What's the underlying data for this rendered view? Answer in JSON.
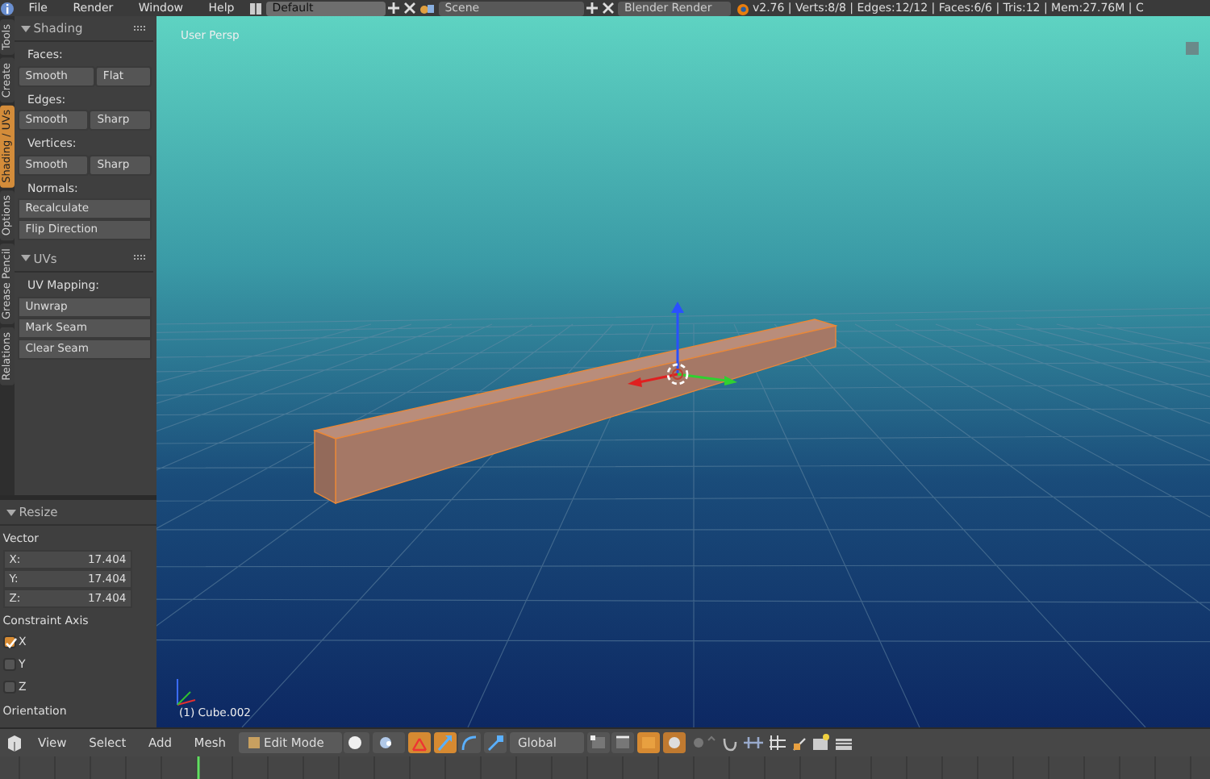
{
  "menubar": {
    "menus": [
      "File",
      "Render",
      "Window",
      "Help"
    ],
    "screen_layout": "Default",
    "scene": "Scene",
    "render_engine": "Blender Render",
    "stats": "v2.76 | Verts:8/8 | Edges:12/12 | Faces:6/6 | Tris:12 | Mem:27.76M | C"
  },
  "tool_tabs": [
    {
      "label": "Tools",
      "selected": false
    },
    {
      "label": "Create",
      "selected": false
    },
    {
      "label": "Shading / UVs",
      "selected": true
    },
    {
      "label": "Options",
      "selected": false
    },
    {
      "label": "Grease Pencil",
      "selected": false
    },
    {
      "label": "Relations",
      "selected": false
    }
  ],
  "tool_panels": [
    {
      "title": "Shading",
      "expanded": true,
      "groups": [
        {
          "label": "Faces:",
          "kind": "row",
          "buttons": [
            "Smooth",
            "Flat"
          ]
        },
        {
          "label": "Edges:",
          "kind": "row",
          "buttons": [
            "Smooth",
            "Sharp"
          ]
        },
        {
          "label": "Vertices:",
          "kind": "row",
          "buttons": [
            "Smooth",
            "Sharp"
          ]
        },
        {
          "label": "Normals:",
          "kind": "column",
          "buttons": [
            "Recalculate",
            "Flip Direction"
          ]
        }
      ]
    },
    {
      "title": "UVs",
      "expanded": true,
      "groups": [
        {
          "label": "UV Mapping:",
          "kind": "column",
          "buttons": [
            "Unwrap",
            "Mark Seam",
            "Clear Seam"
          ]
        }
      ]
    }
  ],
  "operator_panel": {
    "title": "Resize",
    "vector_label": "Vector",
    "vector": [
      {
        "axis": "X:",
        "value": "17.404"
      },
      {
        "axis": "Y:",
        "value": "17.404"
      },
      {
        "axis": "Z:",
        "value": "17.404"
      }
    ],
    "constraint_label": "Constraint Axis",
    "constraints": [
      {
        "label": "X",
        "checked": true
      },
      {
        "label": "Y",
        "checked": false
      },
      {
        "label": "Z",
        "checked": false
      }
    ],
    "orientation_label": "Orientation"
  },
  "viewport": {
    "view_label": "User Persp",
    "object_label": "(1) Cube.002"
  },
  "header": {
    "menus": [
      "View",
      "Select",
      "Add",
      "Mesh"
    ],
    "mode": "Edit Mode",
    "orientation": "Global",
    "manipulators": [
      {
        "kind": "toggle",
        "selected": true
      },
      {
        "kind": "translate",
        "selected": true
      },
      {
        "kind": "rotate",
        "selected": false
      },
      {
        "kind": "scale",
        "selected": false
      }
    ],
    "select_modes": [
      {
        "kind": "vertex",
        "selected": false
      },
      {
        "kind": "edge",
        "selected": false
      },
      {
        "kind": "face",
        "selected": true
      }
    ]
  }
}
